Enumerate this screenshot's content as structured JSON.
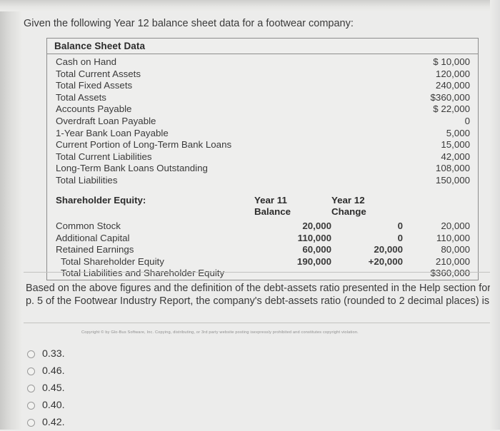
{
  "intro": "Given the following Year 12 balance sheet data for a footwear company:",
  "table": {
    "title": "Balance Sheet Data",
    "rows": [
      {
        "label": "Cash on Hand",
        "value": "$ 10,000",
        "indent": false
      },
      {
        "label": "Total Current Assets",
        "value": "120,000",
        "indent": false
      },
      {
        "label": "Total Fixed Assets",
        "value": "240,000",
        "indent": false
      },
      {
        "label": "Total Assets",
        "value": "$360,000",
        "indent": false
      },
      {
        "label": "Accounts Payable",
        "value": "$ 22,000",
        "indent": false
      },
      {
        "label": "Overdraft Loan Payable",
        "value": "0",
        "indent": false
      },
      {
        "label": "1-Year Bank Loan Payable",
        "value": "5,000",
        "indent": false
      },
      {
        "label": "Current Portion of Long-Term Bank Loans",
        "value": "15,000",
        "indent": false
      },
      {
        "label": "Total Current Liabilities",
        "value": "42,000",
        "indent": false
      },
      {
        "label": "Long-Term Bank Loans Outstanding",
        "value": "108,000",
        "indent": false
      },
      {
        "label": "Total Liabilities",
        "value": "150,000",
        "indent": false
      }
    ],
    "equity": {
      "section_label": "Shareholder Equity:",
      "col1_header_line1": "Year 11",
      "col1_header_line2": "Balance",
      "col2_header_line1": "Year 12",
      "col2_header_line2": "Change",
      "rows": [
        {
          "label": "Common Stock",
          "balance": "20,000",
          "change": "0",
          "total": "20,000",
          "indent": false
        },
        {
          "label": "Additional Capital",
          "balance": "110,000",
          "change": "0",
          "total": "110,000",
          "indent": false
        },
        {
          "label": "Retained Earnings",
          "balance": "60,000",
          "change": "20,000",
          "total": "80,000",
          "indent": false
        },
        {
          "label": "Total Shareholder Equity",
          "balance": "190,000",
          "change": "+20,000",
          "total": "210,000",
          "indent": true
        },
        {
          "label": "Total Liabilities and Shareholder Equity",
          "balance": "",
          "change": "",
          "total": "$360,000",
          "indent": true
        }
      ]
    }
  },
  "question": "Based on the above figures and the definition of the debt-assets ratio presented in the Help section for p. 5 of the Footwear Industry Report, the company's debt-assets ratio (rounded to 2 decimal places) is",
  "copyright": "Copyright © by Glo-Bus Software, Inc. Copying, distributing, or 3rd party website posting isexpressly prohibited and constitutes copyright violation.",
  "options": [
    {
      "label": "0.33."
    },
    {
      "label": "0.46."
    },
    {
      "label": "0.45."
    },
    {
      "label": "0.40."
    },
    {
      "label": "0.42."
    }
  ]
}
